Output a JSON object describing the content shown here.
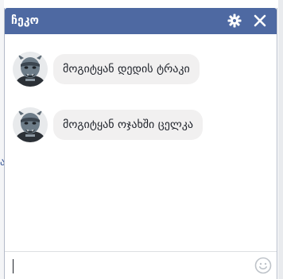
{
  "chat": {
    "title": "ჩეკო",
    "settings_icon": "gear-icon",
    "close_icon": "close-icon",
    "emoji_icon": "smiley-icon",
    "header_color": "#4e69a2",
    "bubble_color": "#f1f0f0"
  },
  "messages": [
    {
      "avatar": "gargoyle-avatar",
      "text": "მოგიტყან დედის ტრაკი"
    },
    {
      "avatar": "gargoyle-avatar",
      "text": "მოგიტყან ოჯახში ცელკა"
    }
  ],
  "composer": {
    "value": "",
    "placeholder": ""
  },
  "background": {
    "glyph": "ა"
  }
}
